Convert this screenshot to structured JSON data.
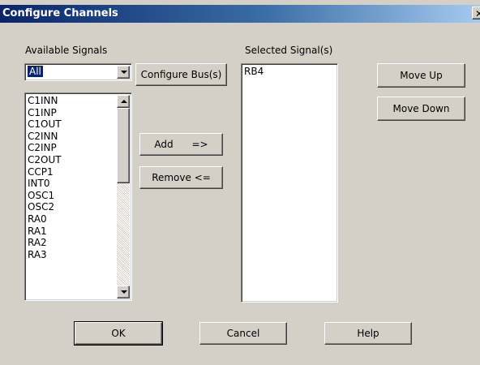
{
  "window": {
    "title": "Configure Channels",
    "close_glyph": "✕"
  },
  "available": {
    "label": "Available Signals",
    "filter_value": "All",
    "items": [
      "C1INN",
      "C1INP",
      "C1OUT",
      "C2INN",
      "C2INP",
      "C2OUT",
      "CCP1",
      "INT0",
      "OSC1",
      "OSC2",
      "RA0",
      "RA1",
      "RA2",
      "RA3"
    ]
  },
  "selected": {
    "label": "Selected Signal(s)",
    "items": [
      "RB4"
    ]
  },
  "buttons": {
    "configure_bus": "Configure Bus(s)",
    "add": "Add      =>",
    "remove": "Remove <=",
    "move_up": "Move Up",
    "move_down": "Move Down",
    "ok": "OK",
    "cancel": "Cancel",
    "help": "Help"
  },
  "icons": {
    "close": "close-icon",
    "dropdown": "chevron-down-icon",
    "scroll_up": "scroll-up-arrow-icon",
    "scroll_down": "scroll-down-arrow-icon"
  },
  "colors": {
    "face": "#d4d0c8",
    "title_start": "#0a246a",
    "title_end": "#a6caf0",
    "selection": "#0a246a"
  }
}
